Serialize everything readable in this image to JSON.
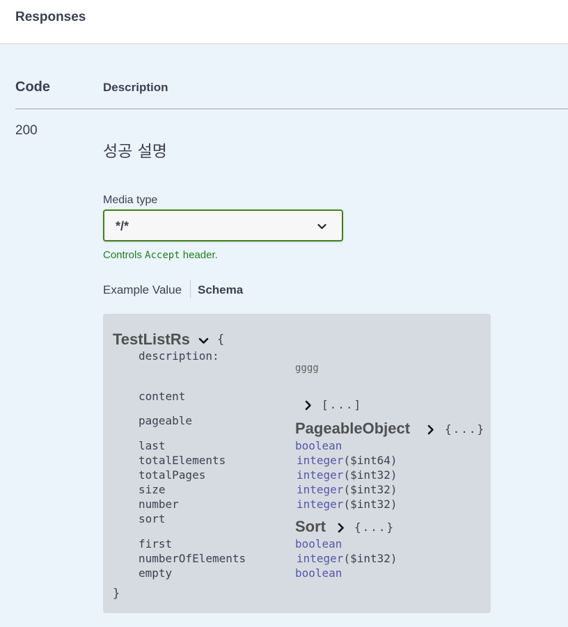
{
  "responses": {
    "title": "Responses"
  },
  "table": {
    "code_header": "Code",
    "description_header": "Description"
  },
  "row": {
    "code": "200",
    "description": "성공 설명",
    "media_type_label": "Media type",
    "media_type_value": "*/*",
    "controls_prefix": "Controls ",
    "controls_accept": "Accept",
    "controls_suffix": " header."
  },
  "tabs": {
    "example": "Example Value",
    "schema": "Schema"
  },
  "schema": {
    "model_name": "TestListRs",
    "open_brace": "{",
    "close_brace": "}",
    "description_label": "description:",
    "description_value": "gggg",
    "properties": [
      {
        "name": "content",
        "type": "",
        "format": "",
        "collapsed": "[...]"
      },
      {
        "name": "pageable",
        "model": "PageableObject",
        "collapsed": "{...}"
      },
      {
        "name": "last",
        "type": "boolean",
        "format": ""
      },
      {
        "name": "totalElements",
        "type": "integer",
        "format": "($int64)"
      },
      {
        "name": "totalPages",
        "type": "integer",
        "format": "($int32)"
      },
      {
        "name": "size",
        "type": "integer",
        "format": "($int32)"
      },
      {
        "name": "number",
        "type": "integer",
        "format": "($int32)"
      },
      {
        "name": "sort",
        "model": "Sort",
        "collapsed": "{...}"
      },
      {
        "name": "first",
        "type": "boolean",
        "format": ""
      },
      {
        "name": "numberOfElements",
        "type": "integer",
        "format": "($int32)"
      },
      {
        "name": "empty",
        "type": "boolean",
        "format": ""
      }
    ]
  },
  "icons": {
    "select": "chevron-down-icon",
    "expand": "chevron-right-icon",
    "collapse": "chevron-down-icon"
  },
  "colors": {
    "accent_green": "#41821c",
    "type_purple": "#5555aa",
    "schema_bg": "#d6dbe1"
  }
}
